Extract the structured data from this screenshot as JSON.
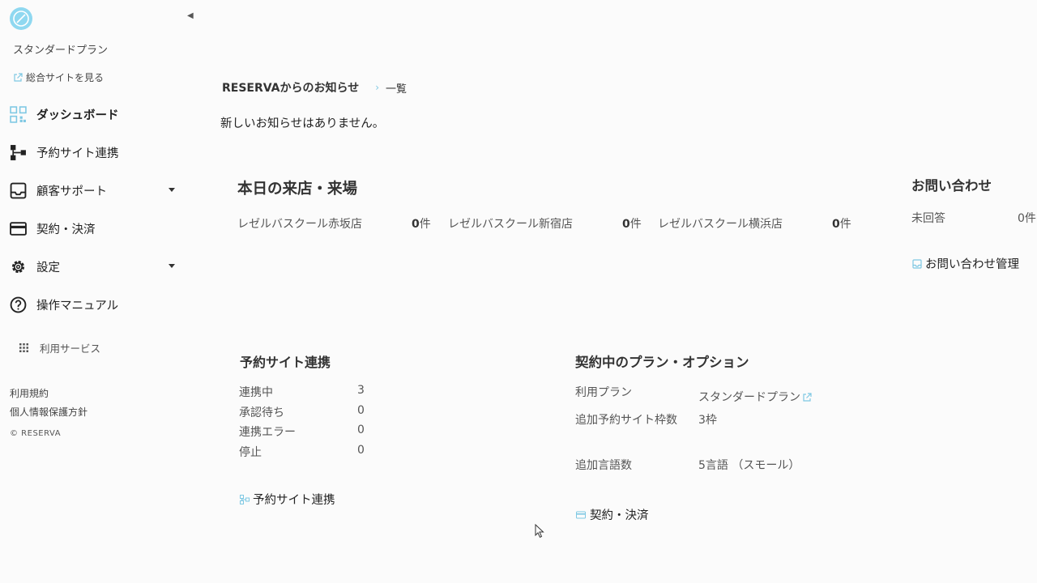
{
  "sidebar": {
    "plan_name": "スタンダードプラン",
    "site_link": "総合サイトを見る",
    "items": [
      {
        "label": "ダッシュボード",
        "icon": "dashboard-icon",
        "active": true
      },
      {
        "label": "予約サイト連携",
        "icon": "sitemap-icon"
      },
      {
        "label": "顧客サポート",
        "icon": "inbox-icon",
        "has_dropdown": true
      },
      {
        "label": "契約・決済",
        "icon": "credit-card-icon"
      },
      {
        "label": "設定",
        "icon": "gear-icon",
        "has_dropdown": true
      },
      {
        "label": "操作マニュアル",
        "icon": "help-icon"
      }
    ],
    "services_label": "利用サービス",
    "footer_links": [
      "利用規約",
      "個人情報保護方針"
    ],
    "copyright": "© RESERVA"
  },
  "news": {
    "title": "RESERVAからのお知らせ",
    "list_link": "一覧",
    "empty_message": "新しいお知らせはありません。"
  },
  "visits": {
    "title": "本日の来店・来場",
    "unit": "件",
    "stores": [
      {
        "name": "レゼルバスクール赤坂店",
        "count": "0"
      },
      {
        "name": "レゼルバスクール新宿店",
        "count": "0"
      },
      {
        "name": "レゼルバスクール横浜店",
        "count": "0"
      }
    ]
  },
  "inquiries": {
    "title": "お問い合わせ",
    "unanswered_label": "未回答",
    "unanswered_value": "0件",
    "manage_link": "お問い合わせ管理"
  },
  "site_sync": {
    "title": "予約サイト連携",
    "rows": [
      {
        "label": "連携中",
        "value": "3"
      },
      {
        "label": "承認待ち",
        "value": "0"
      },
      {
        "label": "連携エラー",
        "value": "0"
      },
      {
        "label": "停止",
        "value": "0"
      }
    ],
    "link": "予約サイト連携"
  },
  "plan": {
    "title": "契約中のプラン・オプション",
    "rows": [
      {
        "label": "利用プラン",
        "value": "スタンダードプラン"
      },
      {
        "label": "追加予約サイト枠数",
        "value": "3枠"
      },
      {
        "label": "追加言語数",
        "value": "5言語 （スモール）"
      }
    ],
    "link": "契約・決済"
  },
  "colors": {
    "accent": "#7ec8e3",
    "background": "#fbfbfb"
  }
}
